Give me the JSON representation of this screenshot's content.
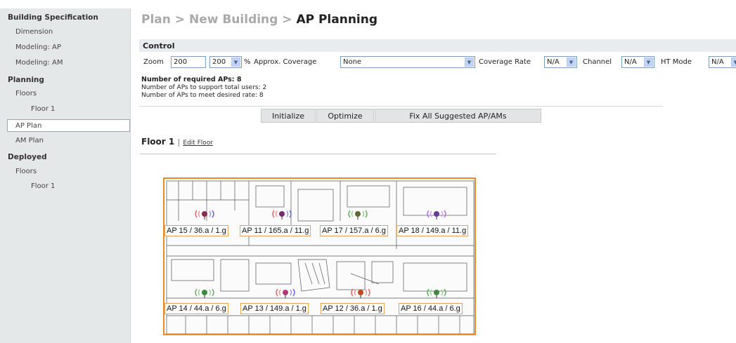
{
  "sidebar": {
    "building_spec": "Building Specification",
    "dimension": "Dimension",
    "modeling_ap": "Modeling: AP",
    "modeling_am": "Modeling: AM",
    "planning": "Planning",
    "floors": "Floors",
    "floor1": "Floor 1",
    "ap_plan": "AP Plan",
    "am_plan": "AM Plan",
    "deployed": "Deployed",
    "dep_floors": "Floors",
    "dep_floor1": "Floor 1"
  },
  "breadcrumb": {
    "plan": "Plan",
    "sep1": ">",
    "new_building": "New Building",
    "sep2": ">",
    "current": "AP Planning"
  },
  "control": {
    "title": "Control",
    "zoom_label": "Zoom",
    "zoom_value": "200",
    "zoom_select": "200",
    "percent": "%",
    "coverage_label": "Approx. Coverage",
    "coverage_value": "None",
    "rate_label": "Coverage Rate",
    "rate_value": "N/A",
    "channel_label": "Channel",
    "channel_value": "N/A",
    "ht_label": "HT Mode",
    "ht_value": "N/A"
  },
  "info": {
    "required": "Number of required APs: 8",
    "users": "Number of APs to support total users: 2",
    "rate": "Number of APs to meet desired rate: 8"
  },
  "buttons": {
    "initialize": "Initialize",
    "optimize": "Optimize",
    "fix_all": "Fix All Suggested AP/AMs"
  },
  "floor": {
    "title": "Floor 1",
    "sep": "|",
    "edit": "Edit Floor"
  },
  "aps": [
    {
      "label": "AP 15 / 36.a / 1.g",
      "color": "#8b2a4e"
    },
    {
      "label": "AP 11 / 165.a / 11.g",
      "color": "#7a2a6e"
    },
    {
      "label": "AP 17 / 157.a / 6.g",
      "color": "#5e6b2c"
    },
    {
      "label": "AP 18 / 149.a / 11.g",
      "color": "#6a3a9a"
    },
    {
      "label": "AP 14 / 44.a / 6.g",
      "color": "#3d8a3d"
    },
    {
      "label": "AP 13 / 149.a / 1.g",
      "color": "#b03a7a"
    },
    {
      "label": "AP 12 / 36.a / 1.g",
      "color": "#c04a1a"
    },
    {
      "label": "AP 16 / 44.a / 6.g",
      "color": "#3d8a3d"
    }
  ],
  "colors": {
    "accent": "#ee8a25",
    "sidebar_bg": "#e5e8e9",
    "control_bg": "#e9ecee"
  }
}
